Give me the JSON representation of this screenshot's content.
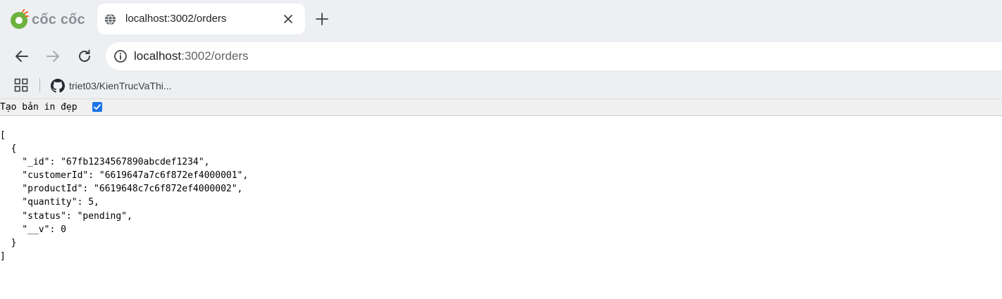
{
  "browser": {
    "brand_name": "cốc cốc",
    "tab": {
      "title": "localhost:3002/orders"
    },
    "address_bar": {
      "host": "localhost",
      "path": ":3002/orders"
    },
    "bookmarks": [
      {
        "label": "triet03/KienTrucVaThi..."
      }
    ]
  },
  "page": {
    "pretty_print": {
      "label": "Tạo bản in đẹp",
      "checked": true
    },
    "json_lines": [
      "[",
      "  {",
      "    \"_id\": \"67fb1234567890abcdef1234\",",
      "    \"customerId\": \"6619647a7c6f872ef4000001\",",
      "    \"productId\": \"6619648c7c6f872ef4000002\",",
      "    \"quantity\": 5,",
      "    \"status\": \"pending\",",
      "    \"__v\": 0",
      "  }",
      "]"
    ]
  },
  "colors": {
    "chrome_bg": "#edeff3",
    "accent": "#1a73e8",
    "logo_green": "#6cb33e",
    "logo_orange": "#f26522"
  },
  "icons": [
    "coccoc-logo-icon",
    "globe-icon",
    "close-icon",
    "plus-icon",
    "back-arrow-icon",
    "forward-arrow-icon",
    "reload-icon",
    "info-icon",
    "apps-grid-icon",
    "github-icon",
    "checkbox-checked-icon"
  ]
}
